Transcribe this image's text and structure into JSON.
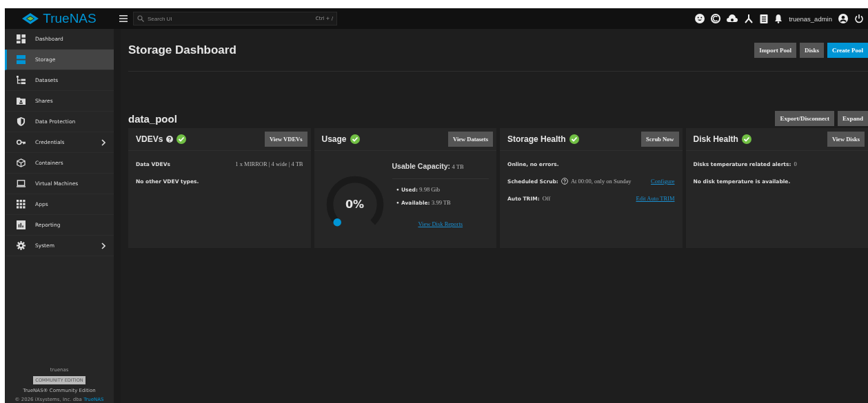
{
  "topbar": {
    "logo": "TrueNAS",
    "search": {
      "placeholder": "Search UI",
      "shortcut": "Ctrl + /"
    },
    "user": "truenas_admin"
  },
  "sidebar": {
    "items": [
      {
        "label": "Dashboard",
        "selected": false,
        "has_children": false
      },
      {
        "label": "Storage",
        "selected": true,
        "has_children": false
      },
      {
        "label": "Datasets",
        "selected": false,
        "has_children": false
      },
      {
        "label": "Shares",
        "selected": false,
        "has_children": false
      },
      {
        "label": "Data Protection",
        "selected": false,
        "has_children": false
      },
      {
        "label": "Credentials",
        "selected": false,
        "has_children": true
      },
      {
        "label": "Containers",
        "selected": false,
        "has_children": false
      },
      {
        "label": "Virtual Machines",
        "selected": false,
        "has_children": false
      },
      {
        "label": "Apps",
        "selected": false,
        "has_children": false
      },
      {
        "label": "Reporting",
        "selected": false,
        "has_children": false
      },
      {
        "label": "System",
        "selected": false,
        "has_children": true
      }
    ],
    "footer": {
      "hostname": "truenas",
      "edition_badge": "COMMUNITY EDITION",
      "product": "TrueNAS® Community Edition",
      "copyright": "© 2026 iXsystems, Inc. dba",
      "copyright_link": "TrueNAS"
    }
  },
  "page": {
    "title": "Storage Dashboard",
    "buttons": [
      {
        "label": "Import Pool",
        "primary": false
      },
      {
        "label": "Disks",
        "primary": false
      },
      {
        "label": "Create Pool",
        "primary": true
      }
    ]
  },
  "pool": {
    "name": "data_pool",
    "buttons": [
      "Export/Disconnect",
      "Expand"
    ],
    "cards": [
      {
        "kind": "vdevs",
        "title": "VDEVs",
        "help": true,
        "healthy": true,
        "button": "View VDEVs",
        "rows": [
          {
            "label": "Data VDEVs",
            "value": "1 x MIRROR | 4 wide |  4 TB"
          }
        ],
        "note": "No other VDEV types."
      },
      {
        "kind": "usage",
        "title": "Usage",
        "help": false,
        "healthy": true,
        "button": "View Datasets",
        "percent": "0%",
        "capacity_label": "Usable Capacity:",
        "capacity_value": "4 TB",
        "stats": [
          {
            "label": "• Used:",
            "value": "9.98 Gib"
          },
          {
            "label": "• Available:",
            "value": "3.99 TB"
          }
        ],
        "link": "View Disk Reports"
      },
      {
        "kind": "health",
        "title": "Storage Health",
        "help": false,
        "healthy": true,
        "button": "Scrub Now",
        "status": "Online, no errors.",
        "rows": [
          {
            "label": "Scheduled Scrub:",
            "help": true,
            "value": "At 00:00, only on Sunday",
            "link": "Configure"
          },
          {
            "label": "Auto TRIM:",
            "help": false,
            "value": "Off",
            "link": "Edit Auto TRIM"
          }
        ]
      },
      {
        "kind": "disks",
        "title": "Disk Health",
        "help": false,
        "healthy": true,
        "button": "View Disks",
        "alerts_label": "Disks temperature related alerts:",
        "alerts_value": "0",
        "note": "No disk temperature is available."
      }
    ]
  }
}
